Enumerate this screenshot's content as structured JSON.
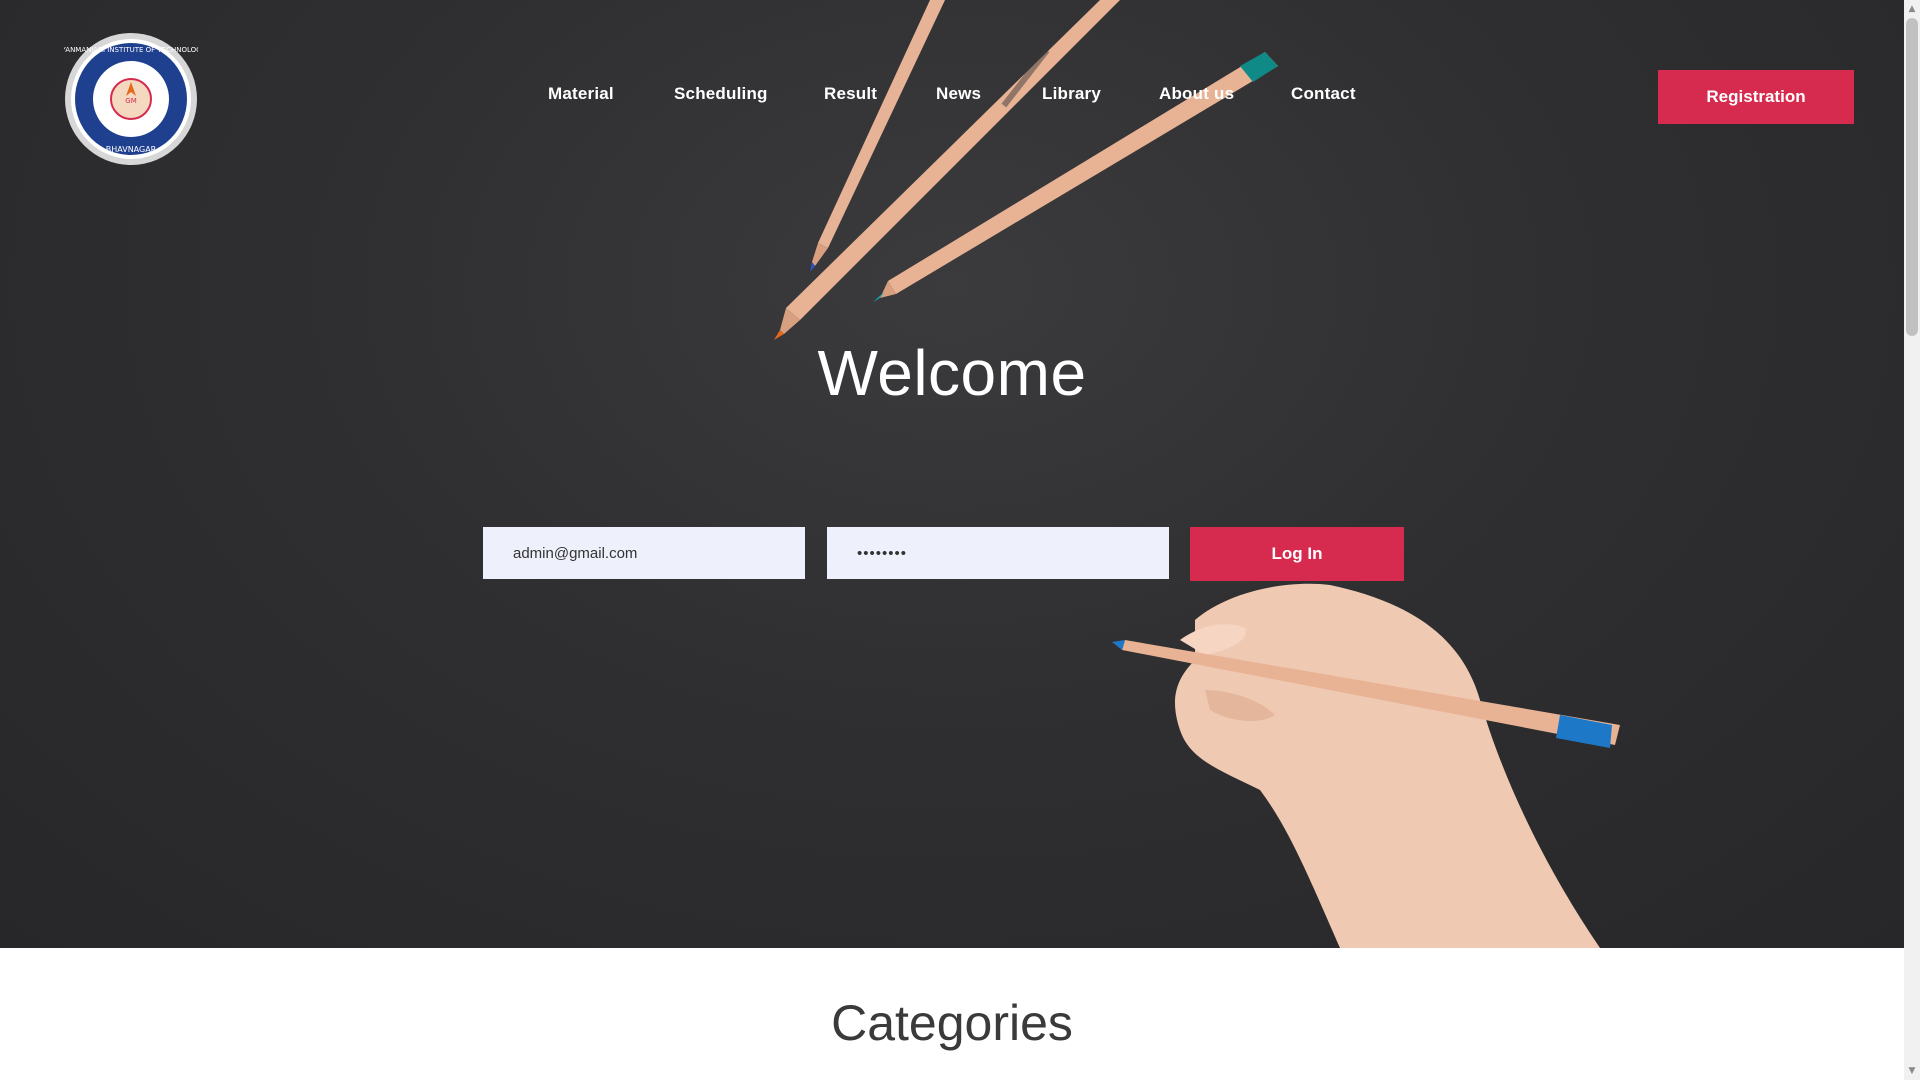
{
  "nav": {
    "items": [
      {
        "label": "Material"
      },
      {
        "label": "Scheduling"
      },
      {
        "label": "Result"
      },
      {
        "label": "News"
      },
      {
        "label": "Library"
      },
      {
        "label": "About us"
      },
      {
        "label": "Contact"
      }
    ],
    "registration_label": "Registration"
  },
  "logo": {
    "top_text": "GYANMANJARI INSTITUTE OF TECHNOLOGY",
    "bottom_text": "BHAVNAGAR"
  },
  "hero": {
    "title": "Welcome"
  },
  "login": {
    "email_value": "admin@gmail.com",
    "password_value": "••••••••",
    "button_label": "Log In"
  },
  "sections": {
    "categories_title": "Categories"
  },
  "colors": {
    "accent": "#d62a4e",
    "hero_bg": "#2f2f31",
    "input_bg": "#eef1fc",
    "logo_blue": "#1f3f8f"
  },
  "icons": {
    "scroll_up": "▲",
    "scroll_down": "▼"
  }
}
